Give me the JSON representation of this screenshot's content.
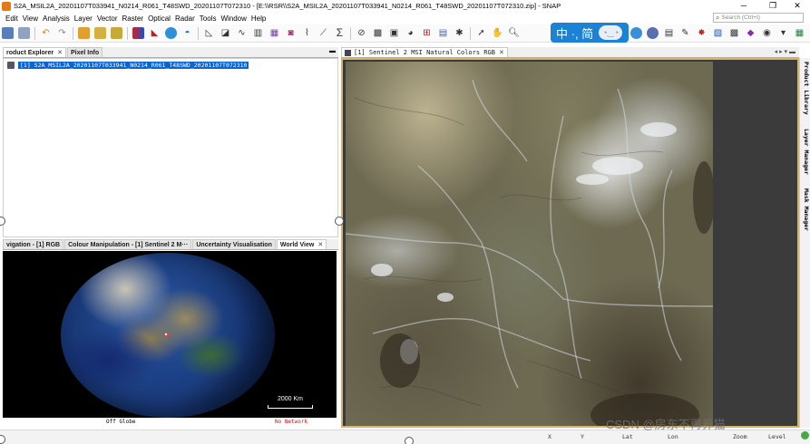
{
  "window": {
    "title": "S2A_MSIL2A_20201107T033941_N0214_R061_T48SWD_20201107T072310 - [E:\\\\RSR\\\\S2A_MSIL2A_20201107T033941_N0214_R061_T48SWD_20201107T072310.zip] - SNAP",
    "minimize": "─",
    "maximize": "❐",
    "close": "✕"
  },
  "menu": [
    "Edit",
    "View",
    "Analysis",
    "Layer",
    "Vector",
    "Raster",
    "Optical",
    "Radar",
    "Tools",
    "Window",
    "Help"
  ],
  "search": {
    "placeholder": "Search (Ctrl+I)"
  },
  "ime": {
    "label": "中 ·, 简",
    "bubble": "◔‿◔"
  },
  "toolbar_icons": [
    "open-product-icon",
    "save-product-icon",
    "undo-icon",
    "redo-icon",
    "band-maths-icon",
    "layer-icon",
    "histogram-icon",
    "color-manipulation-icon",
    "pin-icon",
    "world-map-icon",
    "graph-builder-icon",
    "spectrum-icon",
    "statistics-icon",
    "scatter-plot-icon",
    "profile-plot-icon",
    "sum-icon",
    "mask-icon",
    "vector-icon",
    "gcp-icon",
    "pixel-info-icon",
    "select-tool-icon",
    "pan-tool-icon",
    "zoom-tool-icon",
    "measure-tool-icon"
  ],
  "toolbar_icons_right": [
    "globe-icon",
    "circle-icon",
    "filter-icon",
    "pen-icon",
    "star-icon",
    "range-finder-icon",
    "qr-icon",
    "settings-icon",
    "help-icon"
  ],
  "explorer_tabs": [
    {
      "label": "roduct Explorer",
      "closable": true,
      "active": true
    },
    {
      "label": "Pixel Info",
      "closable": false,
      "active": false
    }
  ],
  "explorer": {
    "product_label": "[1] S2A_MSIL2A_20201107T033941_N0214_R061_T48SWD_20201107T072310"
  },
  "bottom_tabs": [
    {
      "label": "vigation - [1] RGB",
      "active": false
    },
    {
      "label": "Colour Manipulation - [1] Sentinel 2 M···",
      "active": false
    },
    {
      "label": "Uncertainty Visualisation",
      "active": false
    },
    {
      "label": "World View",
      "active": true,
      "closable": true
    }
  ],
  "world_view": {
    "scale": "2000 Km",
    "off_globe": "Off Globe",
    "network": "No Network"
  },
  "image_tab": {
    "label": "[1] Sentinel 2 MSI Natural Colors RGB"
  },
  "side_tabs": [
    "Product Library",
    "Layer Manager",
    "Mask Manager"
  ],
  "statusbar": {
    "x_label": "X",
    "y_label": "Y",
    "lat_label": "Lat",
    "lon_label": "Lon",
    "zoom_label": "Zoom",
    "level_label": "Level"
  },
  "watermark": "CSDN @房东不再养猫",
  "close_glyph": "✕",
  "menu_glyph": "▬"
}
